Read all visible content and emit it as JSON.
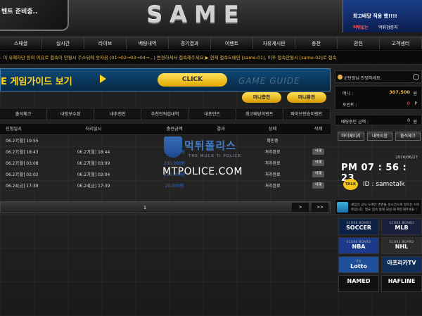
{
  "header": {
    "event_banner": "벤트 준비중..",
    "logo": "SAME",
    "promo": {
      "line1": "최고배당 적용 했!!!!",
      "line2": "먹튀없는",
      "line3": "먹튀검증지"
    }
  },
  "nav": [
    "스페셜",
    "실시간",
    "라이브",
    "베팅내역",
    "경기결과",
    "이벤트",
    "자유게시판",
    "충전",
    "환전",
    "고객센터"
  ],
  "ticker": "- 이 유혜차단 등의 이유로 접속이 안될시 주소뒤에 숫자끔 (01→02→03→04→...) 변경하셔서 접속해주세요  ▶ 현재 접속도메인 [same-01], 이후 접속안될시 [same-02]로 접속",
  "guide": {
    "title": "E 게임가이드 보기",
    "click": "CLICK",
    "label": "GAME GUIDE"
  },
  "buttons": {
    "deposit": "머니충전",
    "withdraw": "머니환전"
  },
  "tabs": [
    "출석체크",
    "내정보수정",
    "내추천인",
    "추천인직립내역",
    "내포인트",
    "최고배당이벤트",
    "파이브번승이벤트"
  ],
  "table": {
    "headers": [
      "신청일시",
      "처리일시",
      "충전금액",
      "결과",
      "상태",
      "삭제"
    ],
    "rows": [
      {
        "req": "06.27[월] 19:55",
        "done": "",
        "amount": "",
        "result": "",
        "status": "확인중",
        "del": ""
      },
      {
        "req": "06.27[월] 18:43",
        "done": "06.27[월] 18:44",
        "amount": "100,000원",
        "result": "",
        "status": "처리완료",
        "del": "삭제"
      },
      {
        "req": "06.27[월] 03:08",
        "done": "06.27[월] 03:09",
        "amount": "200,000원",
        "result": "",
        "status": "처리완료",
        "del": "삭제"
      },
      {
        "req": "06.27[월] 02:02",
        "done": "06.27[월] 02:04",
        "amount": "200,000원",
        "result": "",
        "status": "처리완료",
        "del": "삭제"
      },
      {
        "req": "06.24[금] 17:39",
        "done": "06.24[금] 17:39",
        "amount": "20,000원",
        "result": "",
        "status": "처리완료",
        "del": "삭제"
      }
    ]
  },
  "watermark": {
    "kor": "먹튀폴리스",
    "eng": "THE MUCK TI POLICE",
    "url": "MTPOLICE.COM"
  },
  "pager": {
    "page": "1",
    "next": ">",
    "last": ">>"
  },
  "account": {
    "welcome": "군단장님 안녕하세요.",
    "money_label": "머니 :",
    "money_value": "307,500",
    "money_unit": "원",
    "point_label": "포인트 :",
    "point_value": "0",
    "point_unit": "P",
    "bet_label": "배팅중인 금액 :",
    "bet_value": "0",
    "bet_unit": "원",
    "btn_mypage": "마이페이지",
    "btn_history": "내쪽지함",
    "btn_attend": "출석체크"
  },
  "clock": {
    "date": "2016/06/27",
    "time": "PM 07 : 56 : 23"
  },
  "talk": {
    "bubble": "TALK",
    "id": "ID : sametalk"
  },
  "domain_notice": "새임의 공식 도메인 변경을 실시간으로 알리는 사이트입니다. 필요 접속 방해 되실 때 확인해주세요 !",
  "score_tiles": [
    {
      "small": "SCORE BOARD",
      "big": "SOCCER"
    },
    {
      "small": "SCORE BOARD",
      "big": "MLB"
    },
    {
      "small": "SCORE BOARD",
      "big": "NBA"
    },
    {
      "small": "SCORE BOARD",
      "big": "NHL"
    },
    {
      "small": "나눔",
      "big": "Lotto"
    },
    {
      "small": "",
      "big": "아프리카TV"
    },
    {
      "small": "",
      "big": "NAMED"
    },
    {
      "small": "",
      "big": "HAFLINE"
    }
  ],
  "colors": {
    "accent": "#ffd21e",
    "money": "#e8b84a",
    "link_blue": "#2e74d4",
    "point_red": "#e03030"
  }
}
